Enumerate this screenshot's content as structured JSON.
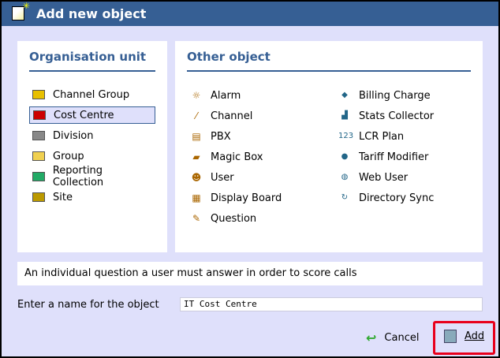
{
  "window": {
    "title": "Add new object"
  },
  "org_unit": {
    "heading": "Organisation unit",
    "items": [
      {
        "label": "Channel Group",
        "icon": "folder-icon",
        "color": "#e8c000"
      },
      {
        "label": "Cost Centre",
        "icon": "cost-centre-icon",
        "color": "#c00"
      },
      {
        "label": "Division",
        "icon": "division-icon",
        "color": "#888"
      },
      {
        "label": "Group",
        "icon": "folder-icon",
        "color": "#f0d050"
      },
      {
        "label": "Reporting Collection",
        "icon": "collection-icon",
        "color": "#2a6"
      },
      {
        "label": "Site",
        "icon": "building-icon",
        "color": "#b90"
      }
    ],
    "selected": "Cost Centre"
  },
  "other": {
    "heading": "Other object",
    "col1": [
      {
        "label": "Alarm",
        "icon": "alarm-icon",
        "glyph": "☼"
      },
      {
        "label": "Channel",
        "icon": "channel-icon",
        "glyph": "⁄"
      },
      {
        "label": "PBX",
        "icon": "pbx-icon",
        "glyph": "▤"
      },
      {
        "label": "Magic Box",
        "icon": "magic-box-icon",
        "glyph": "▰"
      },
      {
        "label": "User",
        "icon": "user-icon",
        "glyph": "☻"
      },
      {
        "label": "Display Board",
        "icon": "display-board-icon",
        "glyph": "▦"
      },
      {
        "label": "Question",
        "icon": "question-icon",
        "glyph": "✎"
      }
    ],
    "col2": [
      {
        "label": "Billing Charge",
        "icon": "billing-charge-icon",
        "glyph": "◆"
      },
      {
        "label": "Stats Collector",
        "icon": "stats-collector-icon",
        "glyph": "▟"
      },
      {
        "label": "LCR Plan",
        "icon": "lcr-plan-icon",
        "glyph": "123"
      },
      {
        "label": "Tariff Modifier",
        "icon": "tariff-modifier-icon",
        "glyph": "●"
      },
      {
        "label": "Web User",
        "icon": "web-user-icon",
        "glyph": "◍"
      },
      {
        "label": "Directory Sync",
        "icon": "directory-sync-icon",
        "glyph": "↻"
      }
    ]
  },
  "description": "An individual question a user must answer in order to score calls",
  "name_field": {
    "label": "Enter a name for the object",
    "value": "IT Cost Centre"
  },
  "buttons": {
    "cancel": "Cancel",
    "add": "Add"
  }
}
